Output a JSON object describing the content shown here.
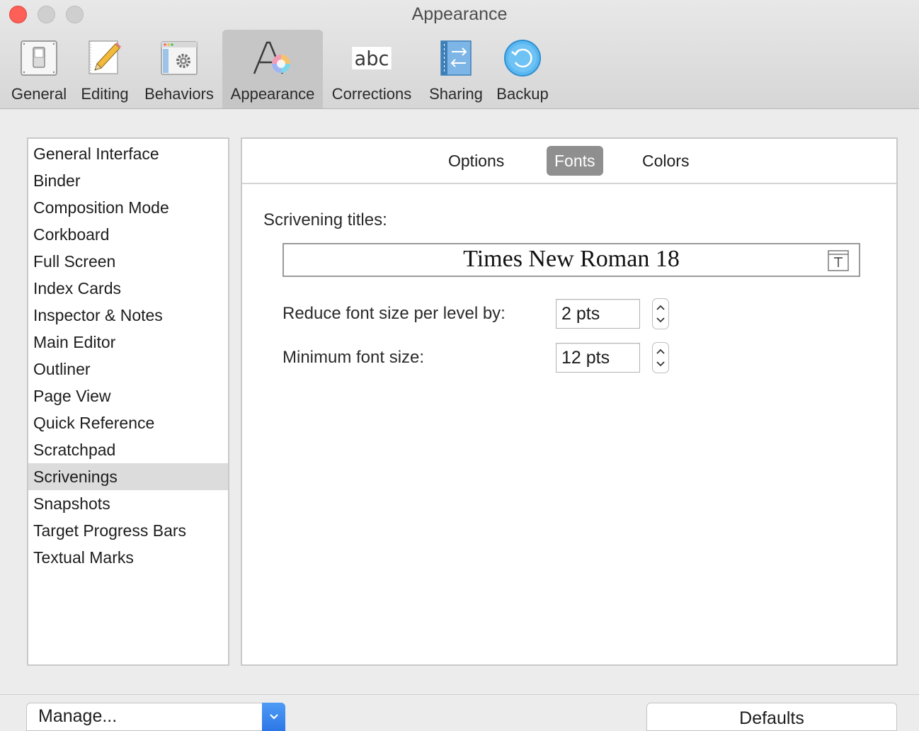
{
  "window": {
    "title": "Appearance"
  },
  "toolbar": {
    "items": [
      {
        "label": "General",
        "icon": "general-switch-icon"
      },
      {
        "label": "Editing",
        "icon": "pencil-icon"
      },
      {
        "label": "Behaviors",
        "icon": "window-gear-icon"
      },
      {
        "label": "Appearance",
        "icon": "font-color-wheel-icon",
        "selected": true
      },
      {
        "label": "Corrections",
        "icon": "abc-icon"
      },
      {
        "label": "Sharing",
        "icon": "sync-arrows-icon"
      },
      {
        "label": "Backup",
        "icon": "backup-icon"
      }
    ]
  },
  "sidebar": {
    "items": [
      "General Interface",
      "Binder",
      "Composition Mode",
      "Corkboard",
      "Full Screen",
      "Index Cards",
      "Inspector & Notes",
      "Main Editor",
      "Outliner",
      "Page View",
      "Quick Reference",
      "Scratchpad",
      "Scrivenings",
      "Snapshots",
      "Target Progress Bars",
      "Textual Marks"
    ],
    "selected": "Scrivenings"
  },
  "tabs": {
    "options": "Options",
    "fonts": "Fonts",
    "colors": "Colors",
    "selected": "Fonts"
  },
  "fonts": {
    "scrivening_titles_label": "Scrivening titles:",
    "scrivening_titles_font": "Times New Roman 18",
    "reduce_label": "Reduce font size per level by:",
    "reduce_value": "2 pts",
    "minimum_label": "Minimum font size:",
    "minimum_value": "12 pts"
  },
  "bottom": {
    "manage_label": "Manage...",
    "defaults_label": "Defaults"
  },
  "colors": {
    "accent": "#2c77e6",
    "close": "#fe5f57",
    "selected_tab": "#8f8f8f",
    "selected_sidebar": "#dcdcdc"
  }
}
